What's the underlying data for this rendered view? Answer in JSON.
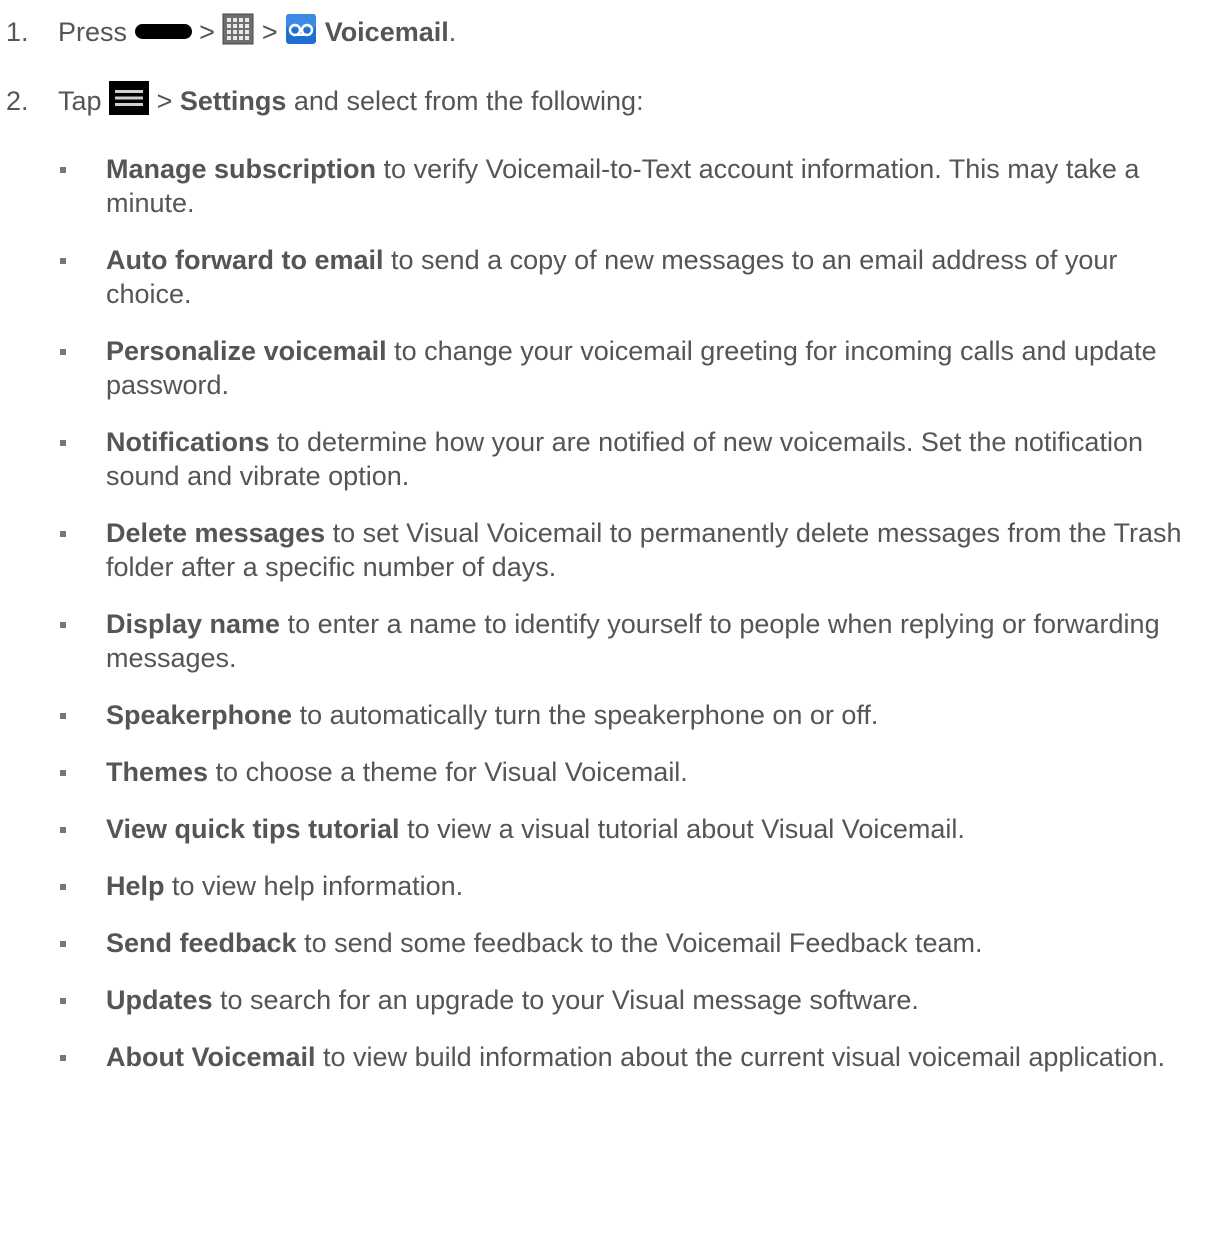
{
  "steps": [
    {
      "number": "1.",
      "prefix": "Press",
      "separator": ">",
      "bold_target": "Voicemail",
      "suffix": "."
    },
    {
      "number": "2.",
      "prefix": "Tap",
      "separator": ">",
      "bold_target": "Settings",
      "suffix": " and select from the following:"
    }
  ],
  "icons": {
    "home": "home-key-icon",
    "apps": "apps-grid-icon",
    "voicemail": "voicemail-icon",
    "menu": "menu-icon"
  },
  "colors": {
    "text": "#555555",
    "icon_dark": "#000000",
    "voicemail_blue": "#1f6fd0"
  },
  "settings": [
    {
      "term": "Manage subscription",
      "desc": " to verify Voicemail-to-Text account information. This may take a minute."
    },
    {
      "term": "Auto forward to email",
      "desc": " to send a copy of new messages to an email address of your choice."
    },
    {
      "term": "Personalize voicemail",
      "desc": " to change your voicemail greeting for incoming calls and update password."
    },
    {
      "term": "Notifications",
      "desc": " to determine how your are notified of new voicemails. Set the notification sound and vibrate option."
    },
    {
      "term": "Delete messages",
      "desc": " to set Visual Voicemail to permanently delete messages from the Trash folder after a specific number of days."
    },
    {
      "term": "Display name",
      "desc": " to enter a name to identify yourself to people when replying or forwarding messages."
    },
    {
      "term": "Speakerphone",
      "desc": " to automatically turn the speakerphone on or off."
    },
    {
      "term": "Themes",
      "desc": " to choose a theme for Visual Voicemail."
    },
    {
      "term": "View quick tips tutorial",
      "desc": " to view a visual tutorial about Visual Voicemail."
    },
    {
      "term": "Help",
      "desc": " to view help information."
    },
    {
      "term": "Send feedback",
      "desc": " to send some feedback to the Voicemail Feedback team."
    },
    {
      "term": "Updates",
      "desc": " to search for an upgrade to your Visual message software."
    },
    {
      "term": "About Voicemail",
      "desc": " to view build information about the current visual voicemail application."
    }
  ]
}
